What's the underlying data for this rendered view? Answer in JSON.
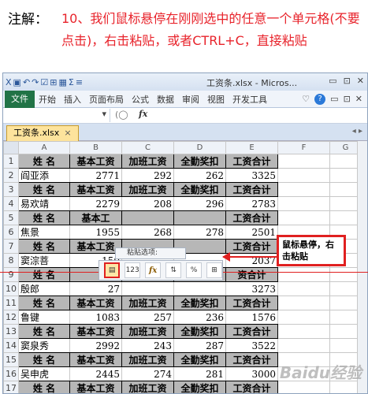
{
  "caption": {
    "prefix": "注解：",
    "text": "10、我们鼠标悬停在刚刚选中的任意一个单元格(不要点击)，右击粘贴，或者CTRL+C，直接粘贴"
  },
  "window": {
    "title": "工资条.xlsx - Micros...",
    "qat": [
      "Ⅹ",
      "▣",
      "↶",
      "↷",
      "☑",
      "⊞",
      "▦",
      "Σ",
      "≡"
    ],
    "controls": [
      "▭",
      "⊡",
      "✕"
    ]
  },
  "ribbon": {
    "file_tab": "文件",
    "tabs": [
      "开始",
      "插入",
      "页面布局",
      "公式",
      "数据",
      "审阅",
      "视图",
      "开发工具"
    ],
    "right": [
      "♡",
      "?",
      "▭",
      "⊡",
      "✕"
    ]
  },
  "formula_bar": {
    "namebox": "▾",
    "zone": "(◯",
    "fx": "fx"
  },
  "workbook_tab": {
    "label": "工资条.xlsx",
    "close": "×",
    "nav": "◂ ▸"
  },
  "columns": [
    "A",
    "B",
    "C",
    "D",
    "E",
    "F",
    "G"
  ],
  "rows": [
    {
      "n": "1",
      "type": "header",
      "cells": [
        "姓  名",
        "基本工资",
        "加班工资",
        "全勤奖扣",
        "工资合计"
      ]
    },
    {
      "n": "2",
      "type": "data",
      "cells": [
        "阎亚添",
        "2771",
        "292",
        "262",
        "3325"
      ]
    },
    {
      "n": "3",
      "type": "header",
      "cells": [
        "姓  名",
        "基本工资",
        "加班工资",
        "全勤奖扣",
        "工资合计"
      ]
    },
    {
      "n": "4",
      "type": "data",
      "cells": [
        "易欢靖",
        "2279",
        "208",
        "296",
        "2783"
      ]
    },
    {
      "n": "5",
      "type": "header",
      "cells": [
        "姓  名",
        "基本工",
        "",
        "",
        "工资合计"
      ]
    },
    {
      "n": "6",
      "type": "data",
      "cells": [
        "焦景",
        "1955",
        "268",
        "278",
        "2501"
      ]
    },
    {
      "n": "7",
      "type": "header",
      "cells": [
        "姓  名",
        "基本工资",
        "",
        "",
        "工资合计"
      ]
    },
    {
      "n": "8",
      "type": "data",
      "cells": [
        "窦淙菩",
        "150",
        "",
        "",
        "2037"
      ]
    },
    {
      "n": "9",
      "type": "header",
      "cells": [
        "姓  名",
        "",
        "",
        "",
        "资合计"
      ]
    },
    {
      "n": "10",
      "type": "data",
      "cells": [
        "殷郎",
        "27",
        "",
        "",
        "3273"
      ]
    },
    {
      "n": "11",
      "type": "header",
      "cells": [
        "姓  名",
        "基本工资",
        "加班工资",
        "全勤奖扣",
        "工资合计"
      ]
    },
    {
      "n": "12",
      "type": "data",
      "cells": [
        "鲁键",
        "1083",
        "257",
        "236",
        "1576"
      ]
    },
    {
      "n": "13",
      "type": "header",
      "cells": [
        "姓  名",
        "基本工资",
        "加班工资",
        "全勤奖扣",
        "工资合计"
      ]
    },
    {
      "n": "14",
      "type": "data",
      "cells": [
        "窦泉秀",
        "2992",
        "243",
        "287",
        "3522"
      ]
    },
    {
      "n": "15",
      "type": "header",
      "cells": [
        "姓  名",
        "基本工资",
        "加班工资",
        "全勤奖扣",
        "工资合计"
      ]
    },
    {
      "n": "16",
      "type": "data",
      "cells": [
        "吴申虎",
        "2445",
        "274",
        "281",
        "3000"
      ]
    },
    {
      "n": "17",
      "type": "header",
      "cells": [
        "姓  名",
        "基本工资",
        "加班工资",
        "全勤奖扣",
        "工资合计"
      ]
    },
    {
      "n": "18",
      "type": "data",
      "cells": [
        "宋成斗",
        "2205",
        "223",
        "244",
        "2672"
      ]
    }
  ],
  "paste_popup": {
    "label": "粘贴选项:",
    "buttons": [
      {
        "name": "paste-default",
        "glyph": "▤"
      },
      {
        "name": "paste-values",
        "glyph": "123"
      },
      {
        "name": "paste-formulas",
        "glyph": "fx"
      },
      {
        "name": "paste-transpose",
        "glyph": "⇅"
      },
      {
        "name": "paste-formatting",
        "glyph": "%"
      },
      {
        "name": "paste-link",
        "glyph": "⊞"
      }
    ]
  },
  "callout": {
    "text": "鼠标悬停，右击粘贴"
  },
  "watermark": "Baidu经验",
  "colors": {
    "accent_red": "#e02020",
    "header_gray": "#b7b7b7",
    "file_tab_green": "#217346"
  }
}
